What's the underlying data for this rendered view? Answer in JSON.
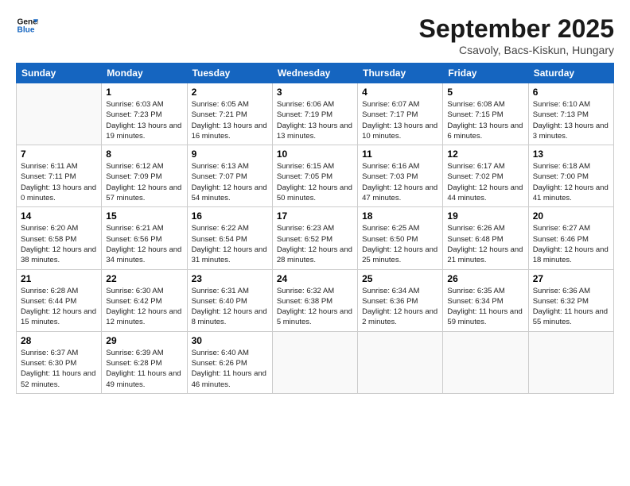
{
  "header": {
    "logo_line1": "General",
    "logo_line2": "Blue",
    "month": "September 2025",
    "location": "Csavoly, Bacs-Kiskun, Hungary"
  },
  "weekdays": [
    "Sunday",
    "Monday",
    "Tuesday",
    "Wednesday",
    "Thursday",
    "Friday",
    "Saturday"
  ],
  "weeks": [
    [
      {
        "day": "",
        "sunrise": "",
        "sunset": "",
        "daylight": ""
      },
      {
        "day": "1",
        "sunrise": "Sunrise: 6:03 AM",
        "sunset": "Sunset: 7:23 PM",
        "daylight": "Daylight: 13 hours and 19 minutes."
      },
      {
        "day": "2",
        "sunrise": "Sunrise: 6:05 AM",
        "sunset": "Sunset: 7:21 PM",
        "daylight": "Daylight: 13 hours and 16 minutes."
      },
      {
        "day": "3",
        "sunrise": "Sunrise: 6:06 AM",
        "sunset": "Sunset: 7:19 PM",
        "daylight": "Daylight: 13 hours and 13 minutes."
      },
      {
        "day": "4",
        "sunrise": "Sunrise: 6:07 AM",
        "sunset": "Sunset: 7:17 PM",
        "daylight": "Daylight: 13 hours and 10 minutes."
      },
      {
        "day": "5",
        "sunrise": "Sunrise: 6:08 AM",
        "sunset": "Sunset: 7:15 PM",
        "daylight": "Daylight: 13 hours and 6 minutes."
      },
      {
        "day": "6",
        "sunrise": "Sunrise: 6:10 AM",
        "sunset": "Sunset: 7:13 PM",
        "daylight": "Daylight: 13 hours and 3 minutes."
      }
    ],
    [
      {
        "day": "7",
        "sunrise": "Sunrise: 6:11 AM",
        "sunset": "Sunset: 7:11 PM",
        "daylight": "Daylight: 13 hours and 0 minutes."
      },
      {
        "day": "8",
        "sunrise": "Sunrise: 6:12 AM",
        "sunset": "Sunset: 7:09 PM",
        "daylight": "Daylight: 12 hours and 57 minutes."
      },
      {
        "day": "9",
        "sunrise": "Sunrise: 6:13 AM",
        "sunset": "Sunset: 7:07 PM",
        "daylight": "Daylight: 12 hours and 54 minutes."
      },
      {
        "day": "10",
        "sunrise": "Sunrise: 6:15 AM",
        "sunset": "Sunset: 7:05 PM",
        "daylight": "Daylight: 12 hours and 50 minutes."
      },
      {
        "day": "11",
        "sunrise": "Sunrise: 6:16 AM",
        "sunset": "Sunset: 7:03 PM",
        "daylight": "Daylight: 12 hours and 47 minutes."
      },
      {
        "day": "12",
        "sunrise": "Sunrise: 6:17 AM",
        "sunset": "Sunset: 7:02 PM",
        "daylight": "Daylight: 12 hours and 44 minutes."
      },
      {
        "day": "13",
        "sunrise": "Sunrise: 6:18 AM",
        "sunset": "Sunset: 7:00 PM",
        "daylight": "Daylight: 12 hours and 41 minutes."
      }
    ],
    [
      {
        "day": "14",
        "sunrise": "Sunrise: 6:20 AM",
        "sunset": "Sunset: 6:58 PM",
        "daylight": "Daylight: 12 hours and 38 minutes."
      },
      {
        "day": "15",
        "sunrise": "Sunrise: 6:21 AM",
        "sunset": "Sunset: 6:56 PM",
        "daylight": "Daylight: 12 hours and 34 minutes."
      },
      {
        "day": "16",
        "sunrise": "Sunrise: 6:22 AM",
        "sunset": "Sunset: 6:54 PM",
        "daylight": "Daylight: 12 hours and 31 minutes."
      },
      {
        "day": "17",
        "sunrise": "Sunrise: 6:23 AM",
        "sunset": "Sunset: 6:52 PM",
        "daylight": "Daylight: 12 hours and 28 minutes."
      },
      {
        "day": "18",
        "sunrise": "Sunrise: 6:25 AM",
        "sunset": "Sunset: 6:50 PM",
        "daylight": "Daylight: 12 hours and 25 minutes."
      },
      {
        "day": "19",
        "sunrise": "Sunrise: 6:26 AM",
        "sunset": "Sunset: 6:48 PM",
        "daylight": "Daylight: 12 hours and 21 minutes."
      },
      {
        "day": "20",
        "sunrise": "Sunrise: 6:27 AM",
        "sunset": "Sunset: 6:46 PM",
        "daylight": "Daylight: 12 hours and 18 minutes."
      }
    ],
    [
      {
        "day": "21",
        "sunrise": "Sunrise: 6:28 AM",
        "sunset": "Sunset: 6:44 PM",
        "daylight": "Daylight: 12 hours and 15 minutes."
      },
      {
        "day": "22",
        "sunrise": "Sunrise: 6:30 AM",
        "sunset": "Sunset: 6:42 PM",
        "daylight": "Daylight: 12 hours and 12 minutes."
      },
      {
        "day": "23",
        "sunrise": "Sunrise: 6:31 AM",
        "sunset": "Sunset: 6:40 PM",
        "daylight": "Daylight: 12 hours and 8 minutes."
      },
      {
        "day": "24",
        "sunrise": "Sunrise: 6:32 AM",
        "sunset": "Sunset: 6:38 PM",
        "daylight": "Daylight: 12 hours and 5 minutes."
      },
      {
        "day": "25",
        "sunrise": "Sunrise: 6:34 AM",
        "sunset": "Sunset: 6:36 PM",
        "daylight": "Daylight: 12 hours and 2 minutes."
      },
      {
        "day": "26",
        "sunrise": "Sunrise: 6:35 AM",
        "sunset": "Sunset: 6:34 PM",
        "daylight": "Daylight: 11 hours and 59 minutes."
      },
      {
        "day": "27",
        "sunrise": "Sunrise: 6:36 AM",
        "sunset": "Sunset: 6:32 PM",
        "daylight": "Daylight: 11 hours and 55 minutes."
      }
    ],
    [
      {
        "day": "28",
        "sunrise": "Sunrise: 6:37 AM",
        "sunset": "Sunset: 6:30 PM",
        "daylight": "Daylight: 11 hours and 52 minutes."
      },
      {
        "day": "29",
        "sunrise": "Sunrise: 6:39 AM",
        "sunset": "Sunset: 6:28 PM",
        "daylight": "Daylight: 11 hours and 49 minutes."
      },
      {
        "day": "30",
        "sunrise": "Sunrise: 6:40 AM",
        "sunset": "Sunset: 6:26 PM",
        "daylight": "Daylight: 11 hours and 46 minutes."
      },
      {
        "day": "",
        "sunrise": "",
        "sunset": "",
        "daylight": ""
      },
      {
        "day": "",
        "sunrise": "",
        "sunset": "",
        "daylight": ""
      },
      {
        "day": "",
        "sunrise": "",
        "sunset": "",
        "daylight": ""
      },
      {
        "day": "",
        "sunrise": "",
        "sunset": "",
        "daylight": ""
      }
    ]
  ]
}
